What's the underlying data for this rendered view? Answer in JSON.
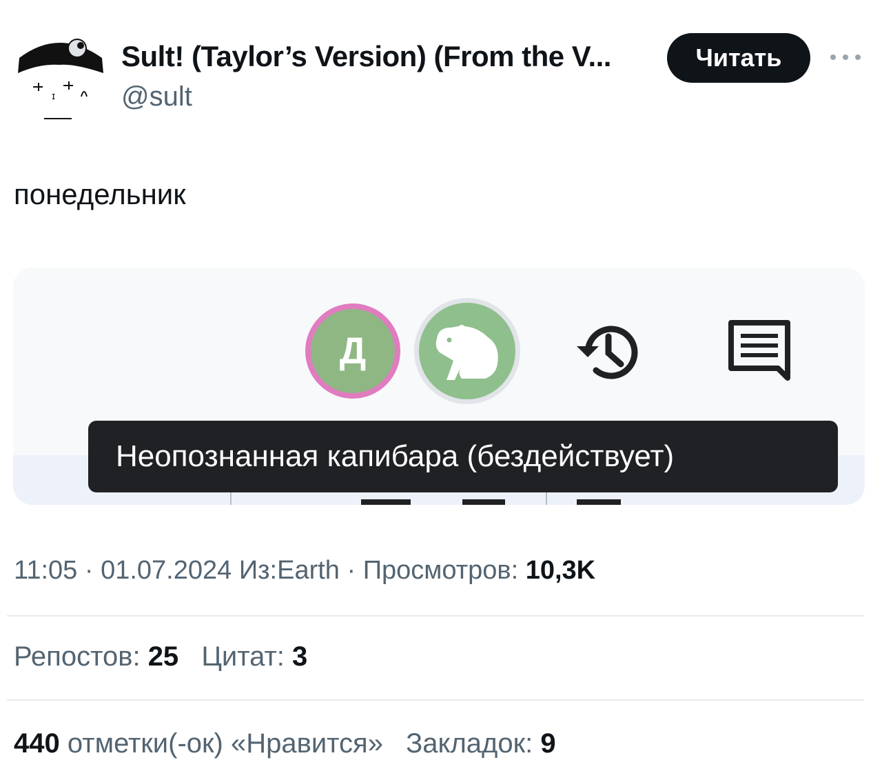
{
  "account": {
    "display_name": "Sult! (Taylor’s Version) (From the V...",
    "handle": "@sult",
    "follow_label": "Читать"
  },
  "tweet": {
    "text": "понедельник"
  },
  "media": {
    "avatar_letter": "Д",
    "tooltip": "Неопознанная капибара (бездействует)"
  },
  "meta": {
    "time": "11:05",
    "date": "01.07.2024",
    "source": "Из:Earth",
    "views_label": "Просмотров:",
    "views_value": "10,3K"
  },
  "stats": {
    "reposts_label": "Репостов:",
    "reposts_value": "25",
    "quotes_label": "Цитат:",
    "quotes_value": "3",
    "likes_value": "440",
    "likes_label": "отметки(-ок) «Нравится»",
    "bookmarks_label": "Закладок:",
    "bookmarks_value": "9"
  },
  "colors": {
    "follow_bg": "#0f1419",
    "secondary_text": "#536471",
    "avatar_green": "#8fb784",
    "avatar_ring_pink": "#e07cc0",
    "tooltip_bg": "#202124"
  },
  "icons": [
    "profile-avatar",
    "more-dots-icon",
    "capybara-icon",
    "history-icon",
    "comment-icon"
  ]
}
